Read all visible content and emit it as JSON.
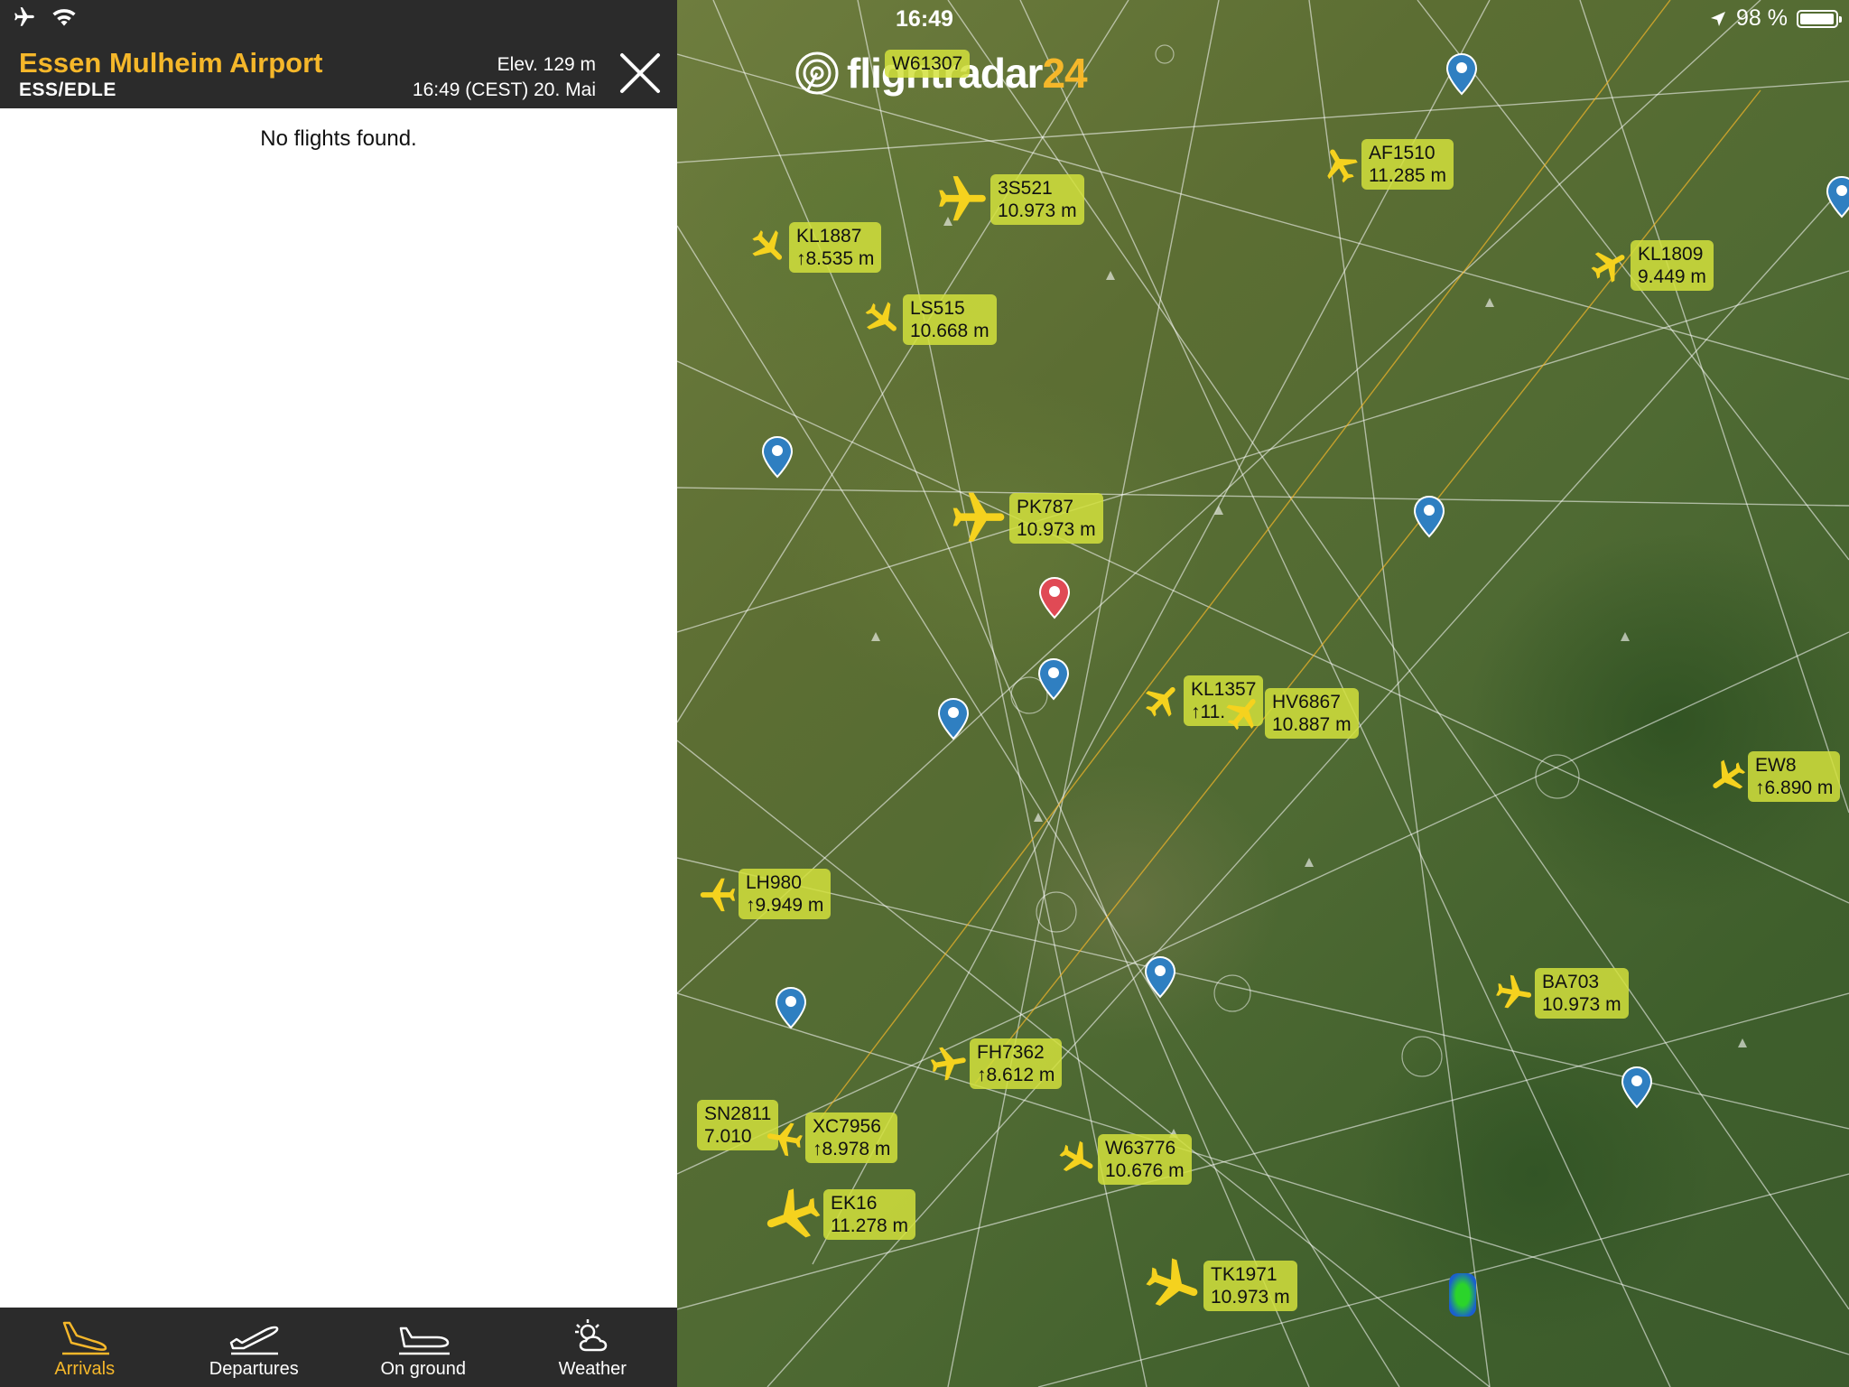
{
  "status_bar": {
    "time": "16:49",
    "battery_text": "98 %",
    "battery_level": 0.98
  },
  "airport": {
    "name": "Essen Mulheim Airport",
    "code": "ESS/EDLE",
    "elevation": "Elev. 129 m",
    "local_time": "16:49 (CEST) 20. Mai"
  },
  "flights_list": {
    "empty_message": "No flights found."
  },
  "tabs": [
    {
      "label": "Arrivals",
      "icon": "arrivals-icon",
      "active": true
    },
    {
      "label": "Departures",
      "icon": "departures-icon",
      "active": false
    },
    {
      "label": "On ground",
      "icon": "on-ground-icon",
      "active": false
    },
    {
      "label": "Weather",
      "icon": "weather-icon",
      "active": false
    }
  ],
  "map": {
    "logo_text": "flightradar",
    "logo_suffix": "24",
    "flights": [
      {
        "callsign": "W61307",
        "altitude": ""
      },
      {
        "callsign": "AF1510",
        "altitude": "11.285 m"
      },
      {
        "callsign": "3S521",
        "altitude": "10.973 m"
      },
      {
        "callsign": "KL1887",
        "altitude": "↑8.535 m"
      },
      {
        "callsign": "KL1809",
        "altitude": "9.449 m"
      },
      {
        "callsign": "LS515",
        "altitude": "10.668 m"
      },
      {
        "callsign": "PK787",
        "altitude": "10.973 m"
      },
      {
        "callsign": "KL1357",
        "altitude": "↑11."
      },
      {
        "callsign": "HV6867",
        "altitude": "10.887 m"
      },
      {
        "callsign": "EW8",
        "altitude": "↑6.890 m"
      },
      {
        "callsign": "LH980",
        "altitude": "↑9.949 m"
      },
      {
        "callsign": "BA703",
        "altitude": "10.973 m"
      },
      {
        "callsign": "FH7362",
        "altitude": "↑8.612 m"
      },
      {
        "callsign": "SN2811",
        "altitude": "7.010"
      },
      {
        "callsign": "XC7956",
        "altitude": "↑8.978 m"
      },
      {
        "callsign": "W63776",
        "altitude": "10.676 m"
      },
      {
        "callsign": "EK16",
        "altitude": "11.278 m"
      },
      {
        "callsign": "TK1971",
        "altitude": "10.973 m"
      }
    ],
    "colors": {
      "accent": "#f5b72a",
      "label_bg": "#d2e13c",
      "pin_blue": "#2f7fc1",
      "pin_red": "#e04a55"
    }
  }
}
